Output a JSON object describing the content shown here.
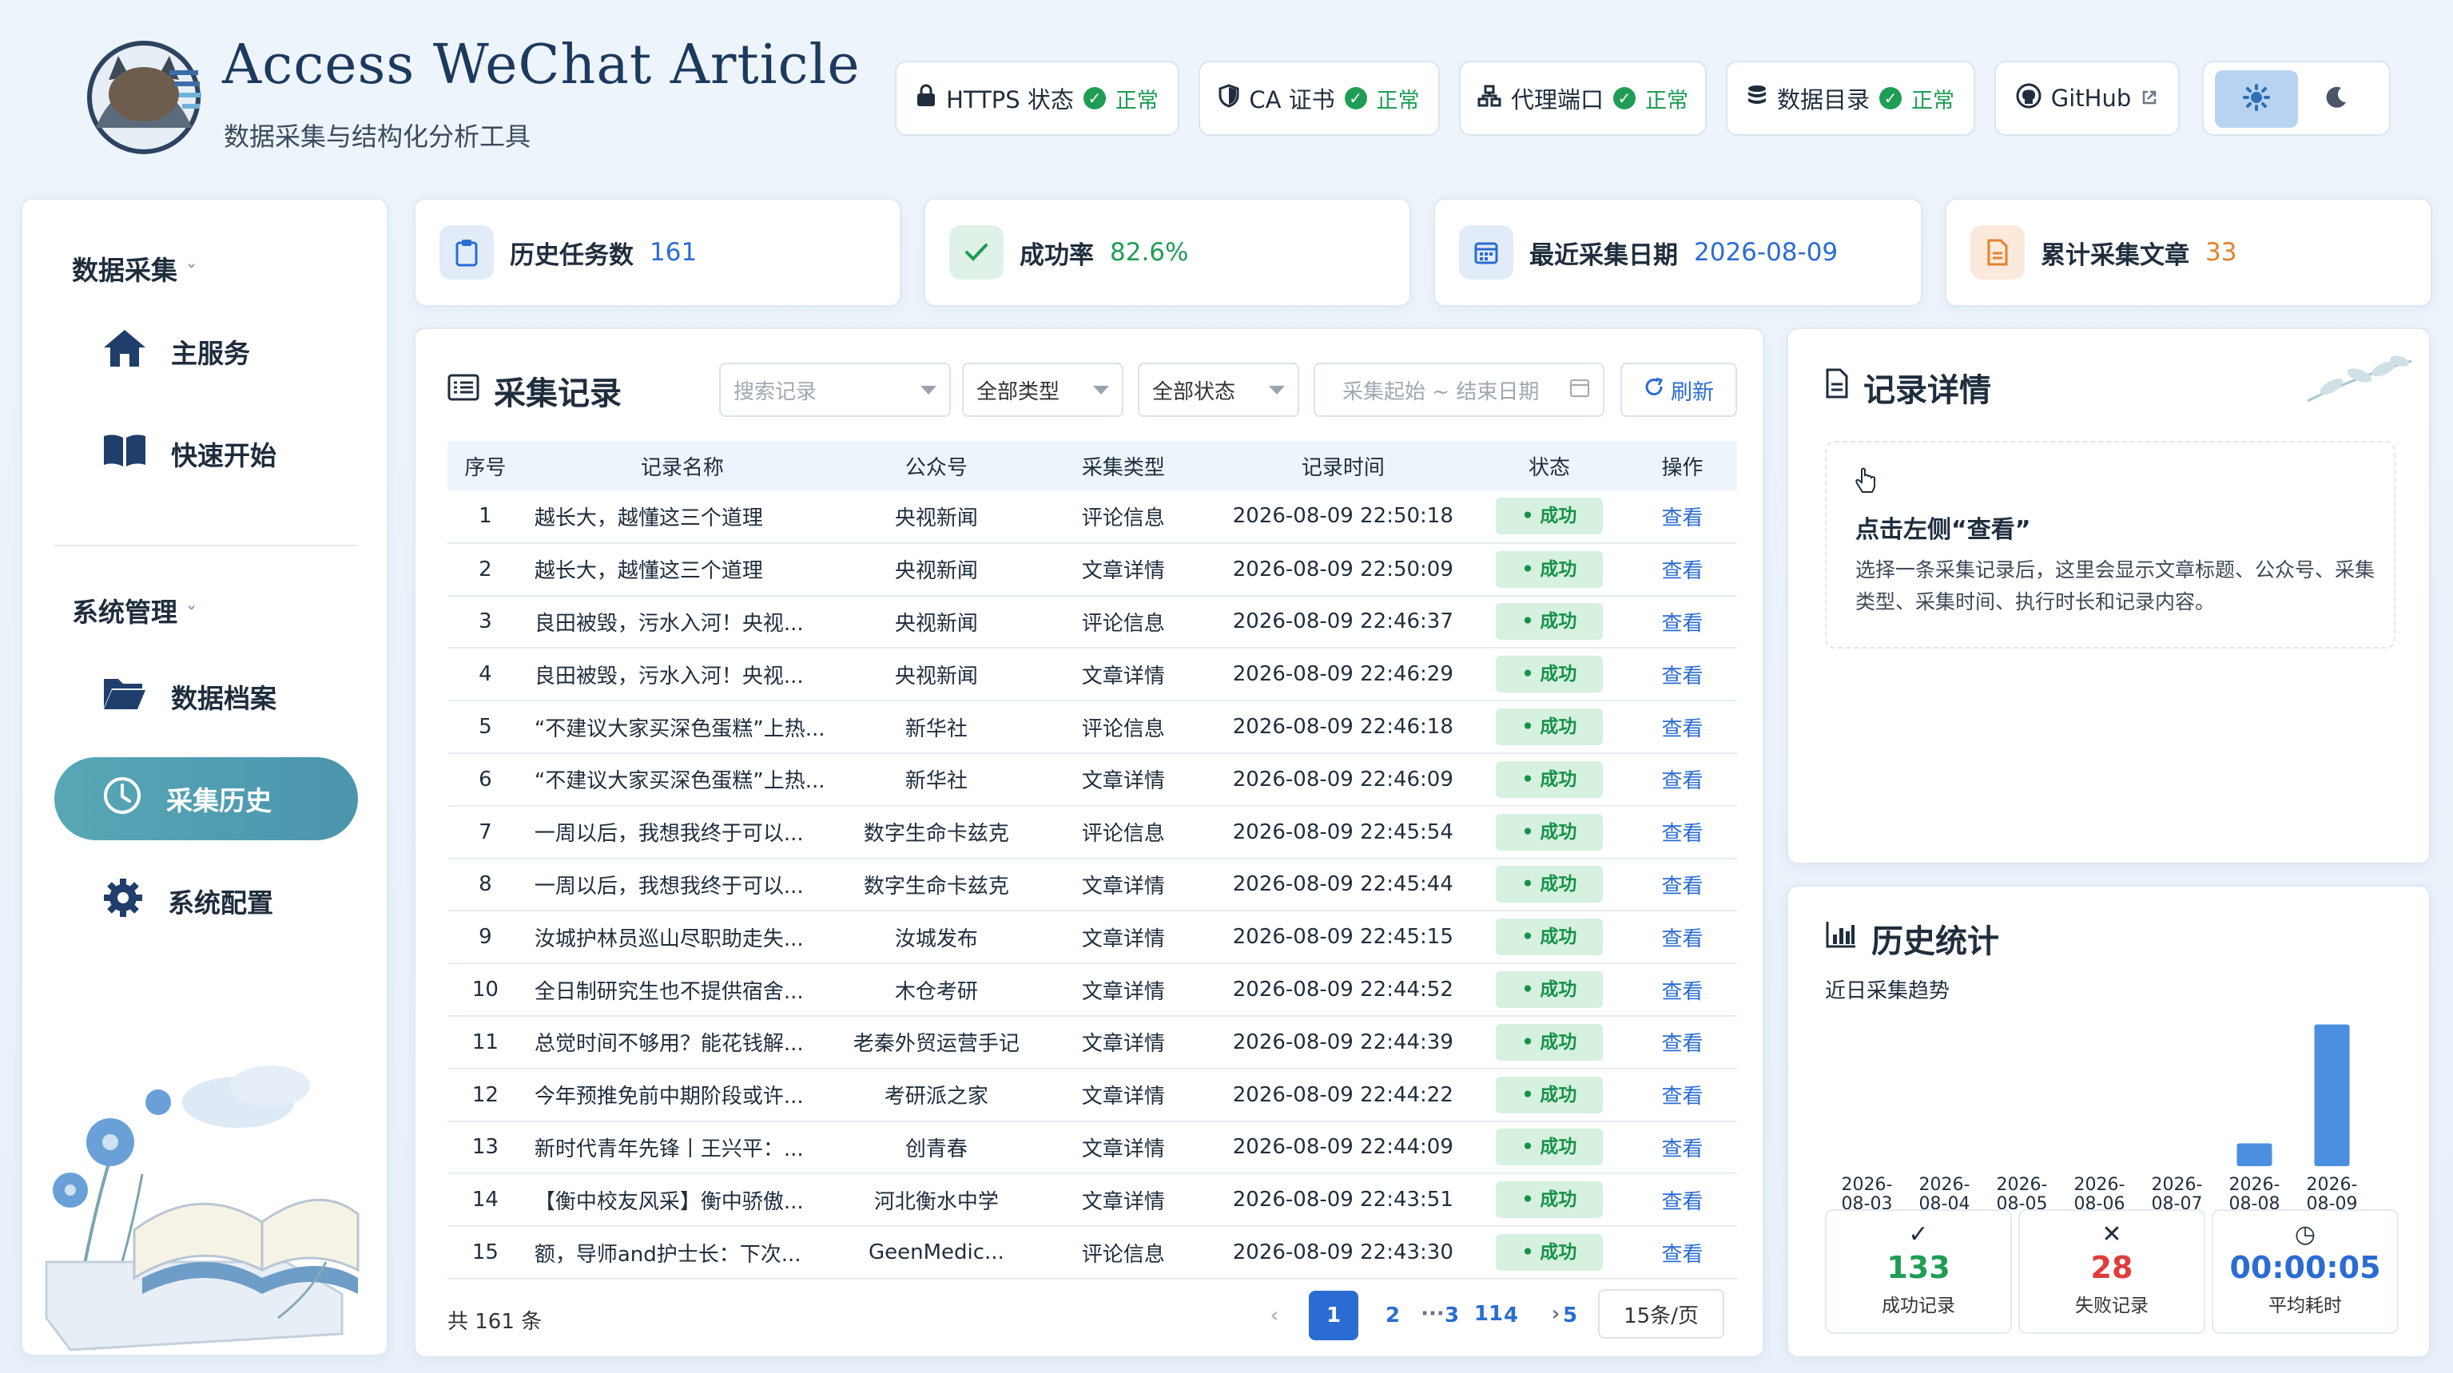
{
  "header": {
    "title": "Access WeChat Article",
    "subtitle": "数据采集与结构化分析工具",
    "status": [
      {
        "label": "HTTPS 状态",
        "state": "正常",
        "icon": "lock-icon"
      },
      {
        "label": "CA 证书",
        "state": "正常",
        "icon": "shield-icon"
      },
      {
        "label": "代理端口",
        "state": "正常",
        "icon": "network-icon"
      },
      {
        "label": "数据目录",
        "state": "正常",
        "icon": "database-icon"
      }
    ],
    "github": "GitHub"
  },
  "sidebar": {
    "section1": "数据采集",
    "section2": "系统管理",
    "items": [
      {
        "label": "主服务",
        "icon": "home-icon"
      },
      {
        "label": "快速开始",
        "icon": "book-icon"
      },
      {
        "label": "数据档案",
        "icon": "folder-icon"
      },
      {
        "label": "采集历史",
        "icon": "clock-icon"
      },
      {
        "label": "系统配置",
        "icon": "gear-icon"
      }
    ]
  },
  "stats": [
    {
      "label": "历史任务数",
      "value": "161",
      "color": "#2b6cd3"
    },
    {
      "label": "成功率",
      "value": "82.6%",
      "color": "#1f9d55"
    },
    {
      "label": "最近采集日期",
      "value": "2026-08-09",
      "color": "#2b6cd3"
    },
    {
      "label": "累计采集文章",
      "value": "33",
      "color": "#e2822b"
    }
  ],
  "records": {
    "title": "采集记录",
    "search_placeholder": "搜索记录",
    "type_filter": "全部类型",
    "status_filter": "全部状态",
    "date_placeholder": "采集起始 ~ 结束日期",
    "refresh": "刷新",
    "columns": [
      "序号",
      "记录名称",
      "公众号",
      "采集类型",
      "记录时间",
      "状态",
      "操作"
    ],
    "rows": [
      [
        "1",
        "越长大，越懂这三个道理",
        "央视新闻",
        "评论信息",
        "2026-08-09 22:50:18"
      ],
      [
        "2",
        "越长大，越懂这三个道理",
        "央视新闻",
        "文章详情",
        "2026-08-09 22:50:09"
      ],
      [
        "3",
        "良田被毁，污水入河！央视...",
        "央视新闻",
        "评论信息",
        "2026-08-09 22:46:37"
      ],
      [
        "4",
        "良田被毁，污水入河！央视...",
        "央视新闻",
        "文章详情",
        "2026-08-09 22:46:29"
      ],
      [
        "5",
        "“不建议大家买深色蛋糕”上热...",
        "新华社",
        "评论信息",
        "2026-08-09 22:46:18"
      ],
      [
        "6",
        "“不建议大家买深色蛋糕”上热...",
        "新华社",
        "文章详情",
        "2026-08-09 22:46:09"
      ],
      [
        "7",
        "一周以后，我想我终于可以...",
        "数字生命卡兹克",
        "评论信息",
        "2026-08-09 22:45:54"
      ],
      [
        "8",
        "一周以后，我想我终于可以...",
        "数字生命卡兹克",
        "文章详情",
        "2026-08-09 22:45:44"
      ],
      [
        "9",
        "汝城护林员巡山尽职助走失...",
        "汝城发布",
        "文章详情",
        "2026-08-09 22:45:15"
      ],
      [
        "10",
        "全日制研究生也不提供宿舍...",
        "木仓考研",
        "文章详情",
        "2026-08-09 22:44:52"
      ],
      [
        "11",
        "总觉时间不够用？能花钱解...",
        "老秦外贸运营手记",
        "文章详情",
        "2026-08-09 22:44:39"
      ],
      [
        "12",
        "今年预推免前中期阶段或许...",
        "考研派之家",
        "文章详情",
        "2026-08-09 22:44:22"
      ],
      [
        "13",
        "新时代青年先锋丨王兴平：...",
        "创青春",
        "文章详情",
        "2026-08-09 22:44:09"
      ],
      [
        "14",
        "【衡中校友风采】衡中骄傲...",
        "河北衡水中学",
        "文章详情",
        "2026-08-09 22:43:51"
      ],
      [
        "15",
        "额，导师and护士长：下次...",
        "GeenMedic...",
        "评论信息",
        "2026-08-09 22:43:30"
      ]
    ],
    "status_label": "成功",
    "action_label": "查看",
    "total": "共 161 条",
    "pages": [
      "1",
      "2",
      "3",
      "4",
      "5",
      "···",
      "11"
    ],
    "page_size": "15条/页"
  },
  "details": {
    "title": "记录详情",
    "hint": "点击左侧“查看”",
    "desc": "选择一条采集记录后，这里会显示文章标题、公众号、采集类型、采集时间、执行时长和记录内容。"
  },
  "history": {
    "title": "历史统计",
    "subtitle": "近日采集趋势",
    "chart_data": {
      "type": "bar",
      "categories": [
        "2026-08-03",
        "2026-08-04",
        "2026-08-05",
        "2026-08-06",
        "2026-08-07",
        "2026-08-08",
        "2026-08-09"
      ],
      "values": [
        0,
        0,
        0,
        0,
        0,
        18,
        112
      ],
      "ylim": [
        0,
        120
      ]
    },
    "tiles": [
      {
        "value": "133",
        "label": "成功记录",
        "icon": "check-icon",
        "color": "#1f9d55"
      },
      {
        "value": "28",
        "label": "失败记录",
        "icon": "x-icon",
        "color": "#e03c3c"
      },
      {
        "value": "00:00:05",
        "label": "平均耗时",
        "icon": "clock-icon",
        "color": "#2b6cd3"
      }
    ]
  }
}
